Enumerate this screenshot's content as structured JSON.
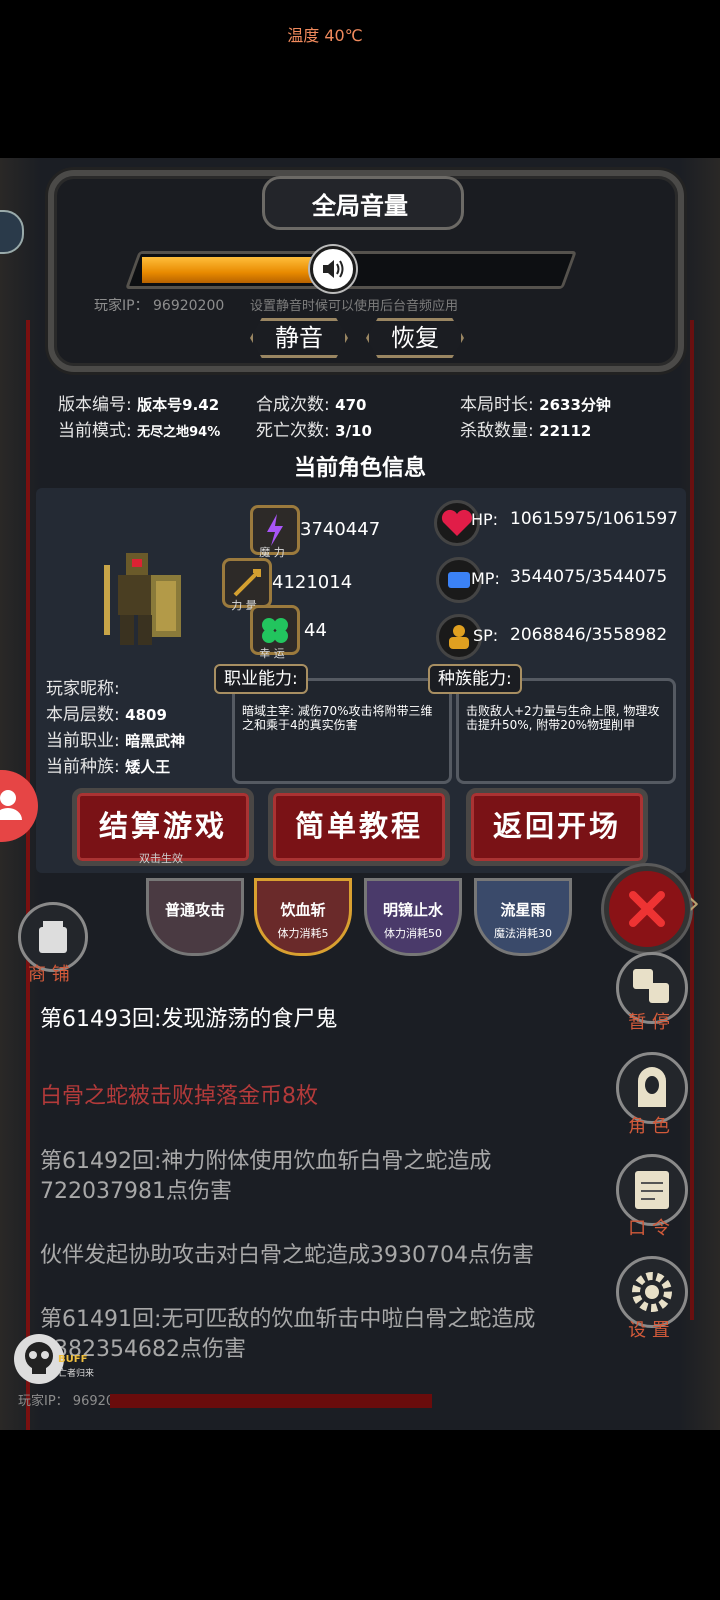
{
  "status": {
    "temperature": "温度 40℃"
  },
  "volume": {
    "title": "全局音量",
    "level_percent": 45,
    "player_ip": "玩家IP：  96920200",
    "hint": "设置静音时候可以使用后台音频应用",
    "mute_label": "静音",
    "restore_label": "恢复"
  },
  "stats": {
    "version_label": "版本编号:",
    "version_value": "版本号9.42",
    "mode_label": "当前模式:",
    "mode_value": "无尽之地94%",
    "synth_label": "合成次数:",
    "synth_value": "470",
    "death_label": "死亡次数:",
    "death_value": "3/10",
    "duration_label": "本局时长:",
    "duration_value": "2633分钟",
    "kills_label": "杀敌数量:",
    "kills_value": "22112"
  },
  "character": {
    "header": "当前角色信息",
    "magic_value": "3740447",
    "magic_caption": "魔 力",
    "power_value": "4121014",
    "power_caption": "力 量",
    "luck_value": "44",
    "luck_caption": "幸 运",
    "hp_label": "HP:",
    "hp_value": "10615975/1061597",
    "mp_label": "MP:",
    "mp_value": "3544075/3544075",
    "sp_label": "SP:",
    "sp_value": "2068846/3558982",
    "nickname_label": "玩家昵称:",
    "floor_label": "本局层数:",
    "floor_value": "4809",
    "job_label": "当前职业:",
    "job_value": "暗黑武神",
    "race_label": "当前种族:",
    "race_value": "矮人王",
    "job_ability_title": "职业能力:",
    "job_ability_text": "暗域主宰: 减伤70%攻击将附带三维之和乘于4的真实伤害",
    "race_ability_title": "种族能力:",
    "race_ability_text": "击败敌人+2力量与生命上限, 物理攻击提升50%, 附带20%物理削甲"
  },
  "actions": {
    "settle": "结算游戏",
    "settle_sub": "双击生效",
    "tutorial": "简单教程",
    "back": "返回开场"
  },
  "skills": [
    {
      "name": "普通攻击",
      "cost": ""
    },
    {
      "name": "饮血斩",
      "cost": "体力消耗5"
    },
    {
      "name": "明镜止水",
      "cost": "体力消耗50"
    },
    {
      "name": "流星雨",
      "cost": "魔法消耗30"
    }
  ],
  "shop_label": "商 铺",
  "log": [
    {
      "text": "第61493回:发现游荡的食尸鬼",
      "color": "#ffffff"
    },
    {
      "text": "白骨之蛇被击败掉落金币8枚",
      "color": "#b33a3a"
    },
    {
      "text": "第61492回:神力附体使用饮血斩白骨之蛇造成722037981点伤害",
      "color": "#a8a8a8"
    },
    {
      "text": "伙伴发起协助攻击对白骨之蛇造成3930704点伤害",
      "color": "#a8a8a8"
    },
    {
      "text": "第61491回:无可匹敌的饮血斩击中啦白骨之蛇造成2382354682点伤害",
      "color": "#a8a8a8"
    }
  ],
  "side": {
    "pause": "暂 停",
    "role": "角 色",
    "code": "口 令",
    "settings": "设 置"
  },
  "buff": {
    "label": "BUFF",
    "sub": "亡者归来"
  },
  "bottom_ip": "玩家IP：  96920200",
  "colors": {
    "accent_orange": "#f0a020",
    "dark_red": "#7a1216",
    "label_red": "#d25a3a"
  }
}
